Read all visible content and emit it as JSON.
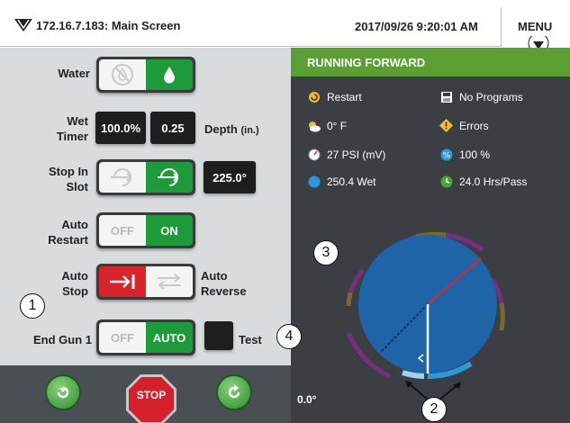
{
  "header": {
    "title": "172.16.7.183: Main Screen",
    "datetime": "2017/09/26 9:20:01 AM",
    "menu_label": "MENU"
  },
  "controls": {
    "water": {
      "label": "Water"
    },
    "wet_timer": {
      "label_line1": "Wet",
      "label_line2": "Timer",
      "percent": "100.0%",
      "depth": "0.25",
      "depth_label": "Depth",
      "depth_unit": "(in.)"
    },
    "stop_in_slot": {
      "label_line1": "Stop In",
      "label_line2": "Slot",
      "angle": "225.0°"
    },
    "auto_restart": {
      "label_line1": "Auto",
      "label_line2": "Restart",
      "off": "OFF",
      "on": "ON"
    },
    "auto_stop": {
      "label_line1": "Auto",
      "label_line2": "Stop",
      "right_line1": "Auto",
      "right_line2": "Reverse"
    },
    "end_gun": {
      "label": "End Gun 1",
      "off": "OFF",
      "on": "AUTO",
      "test_label": "Test"
    }
  },
  "bottom": {
    "stop_label": "STOP"
  },
  "status": {
    "state": "RUNNING FORWARD",
    "items": [
      {
        "icon": "restart-icon",
        "text": "Restart"
      },
      {
        "icon": "programs-icon",
        "text": "No Programs"
      },
      {
        "icon": "weather-icon",
        "text": "0° F"
      },
      {
        "icon": "errors-icon",
        "text": "Errors"
      },
      {
        "icon": "pressure-icon",
        "text": "27 PSI (mV)"
      },
      {
        "icon": "percent-icon",
        "text": "100 %"
      },
      {
        "icon": "wet-icon",
        "text": "250.4 Wet"
      },
      {
        "icon": "hrs-icon",
        "text": "24.0 Hrs/Pass"
      }
    ],
    "angle": "0.0°"
  },
  "callouts": [
    "1",
    "2",
    "3",
    "4"
  ],
  "colors": {
    "status_green": "#5b9e33",
    "toggle_green": "#1d9a3a",
    "field_blue": "#1f63a8",
    "dark_panel": "#3b3f43"
  }
}
